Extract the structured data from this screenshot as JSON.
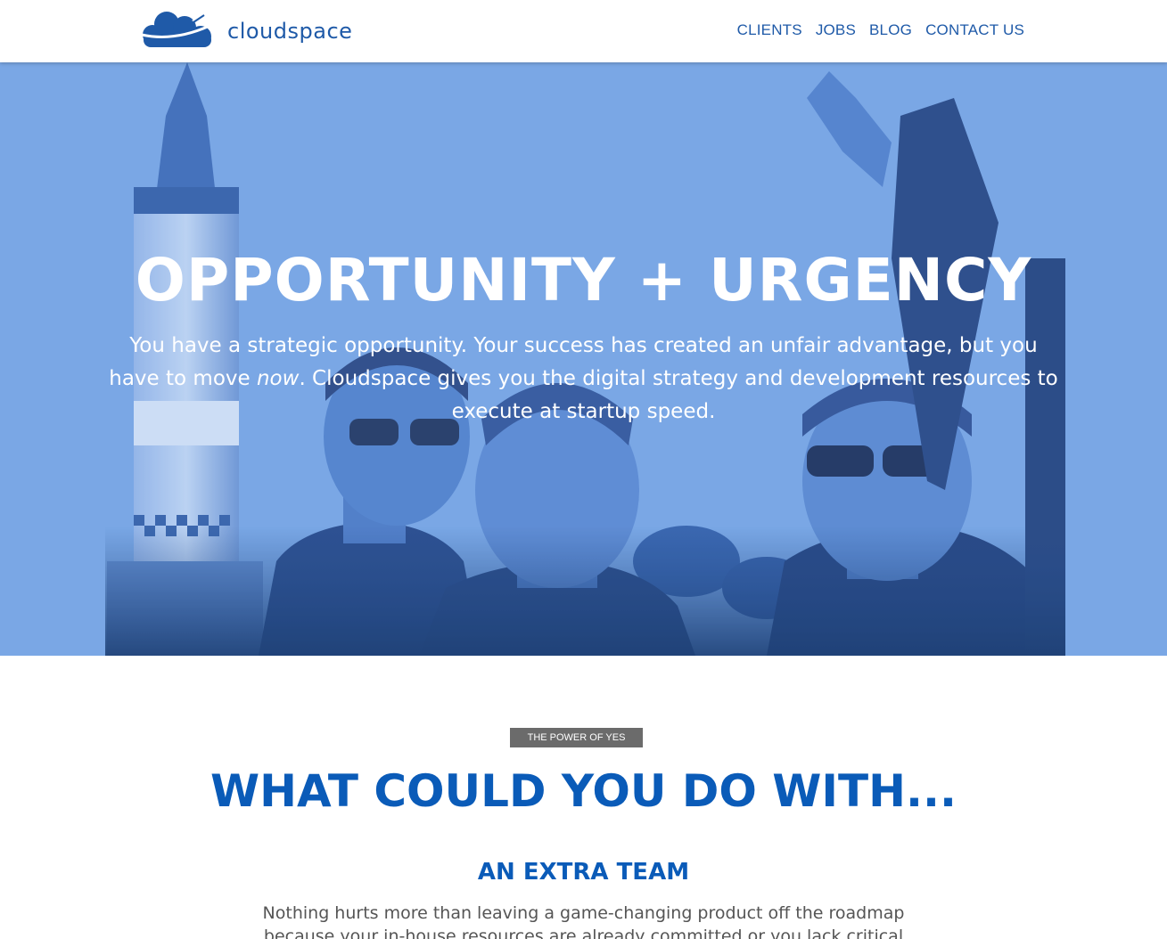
{
  "brand": {
    "name": "cloudspace",
    "color": "#1f5aa8"
  },
  "nav": {
    "items": [
      "CLIENTS",
      "JOBS",
      "BLOG",
      "CONTACT US"
    ]
  },
  "hero": {
    "title": "OPPORTUNITY + URGENCY",
    "text_before": "You have a strategic opportunity. Your success has created an unfair advantage, but you have to move ",
    "text_emphasis": "now",
    "text_after": ". Cloudspace gives you the digital strategy and development resources to execute at startup speed.",
    "tint": "#7aa8e6"
  },
  "section": {
    "badge": "THE POWER OF YES",
    "title": "WHAT COULD YOU DO WITH...",
    "subtitle": "AN EXTRA TEAM",
    "body": "Nothing hurts more than leaving a game-changing product off the roadmap because your in-house resources are already committed or you lack critical expertise.",
    "accent": "#0a5bb8"
  }
}
